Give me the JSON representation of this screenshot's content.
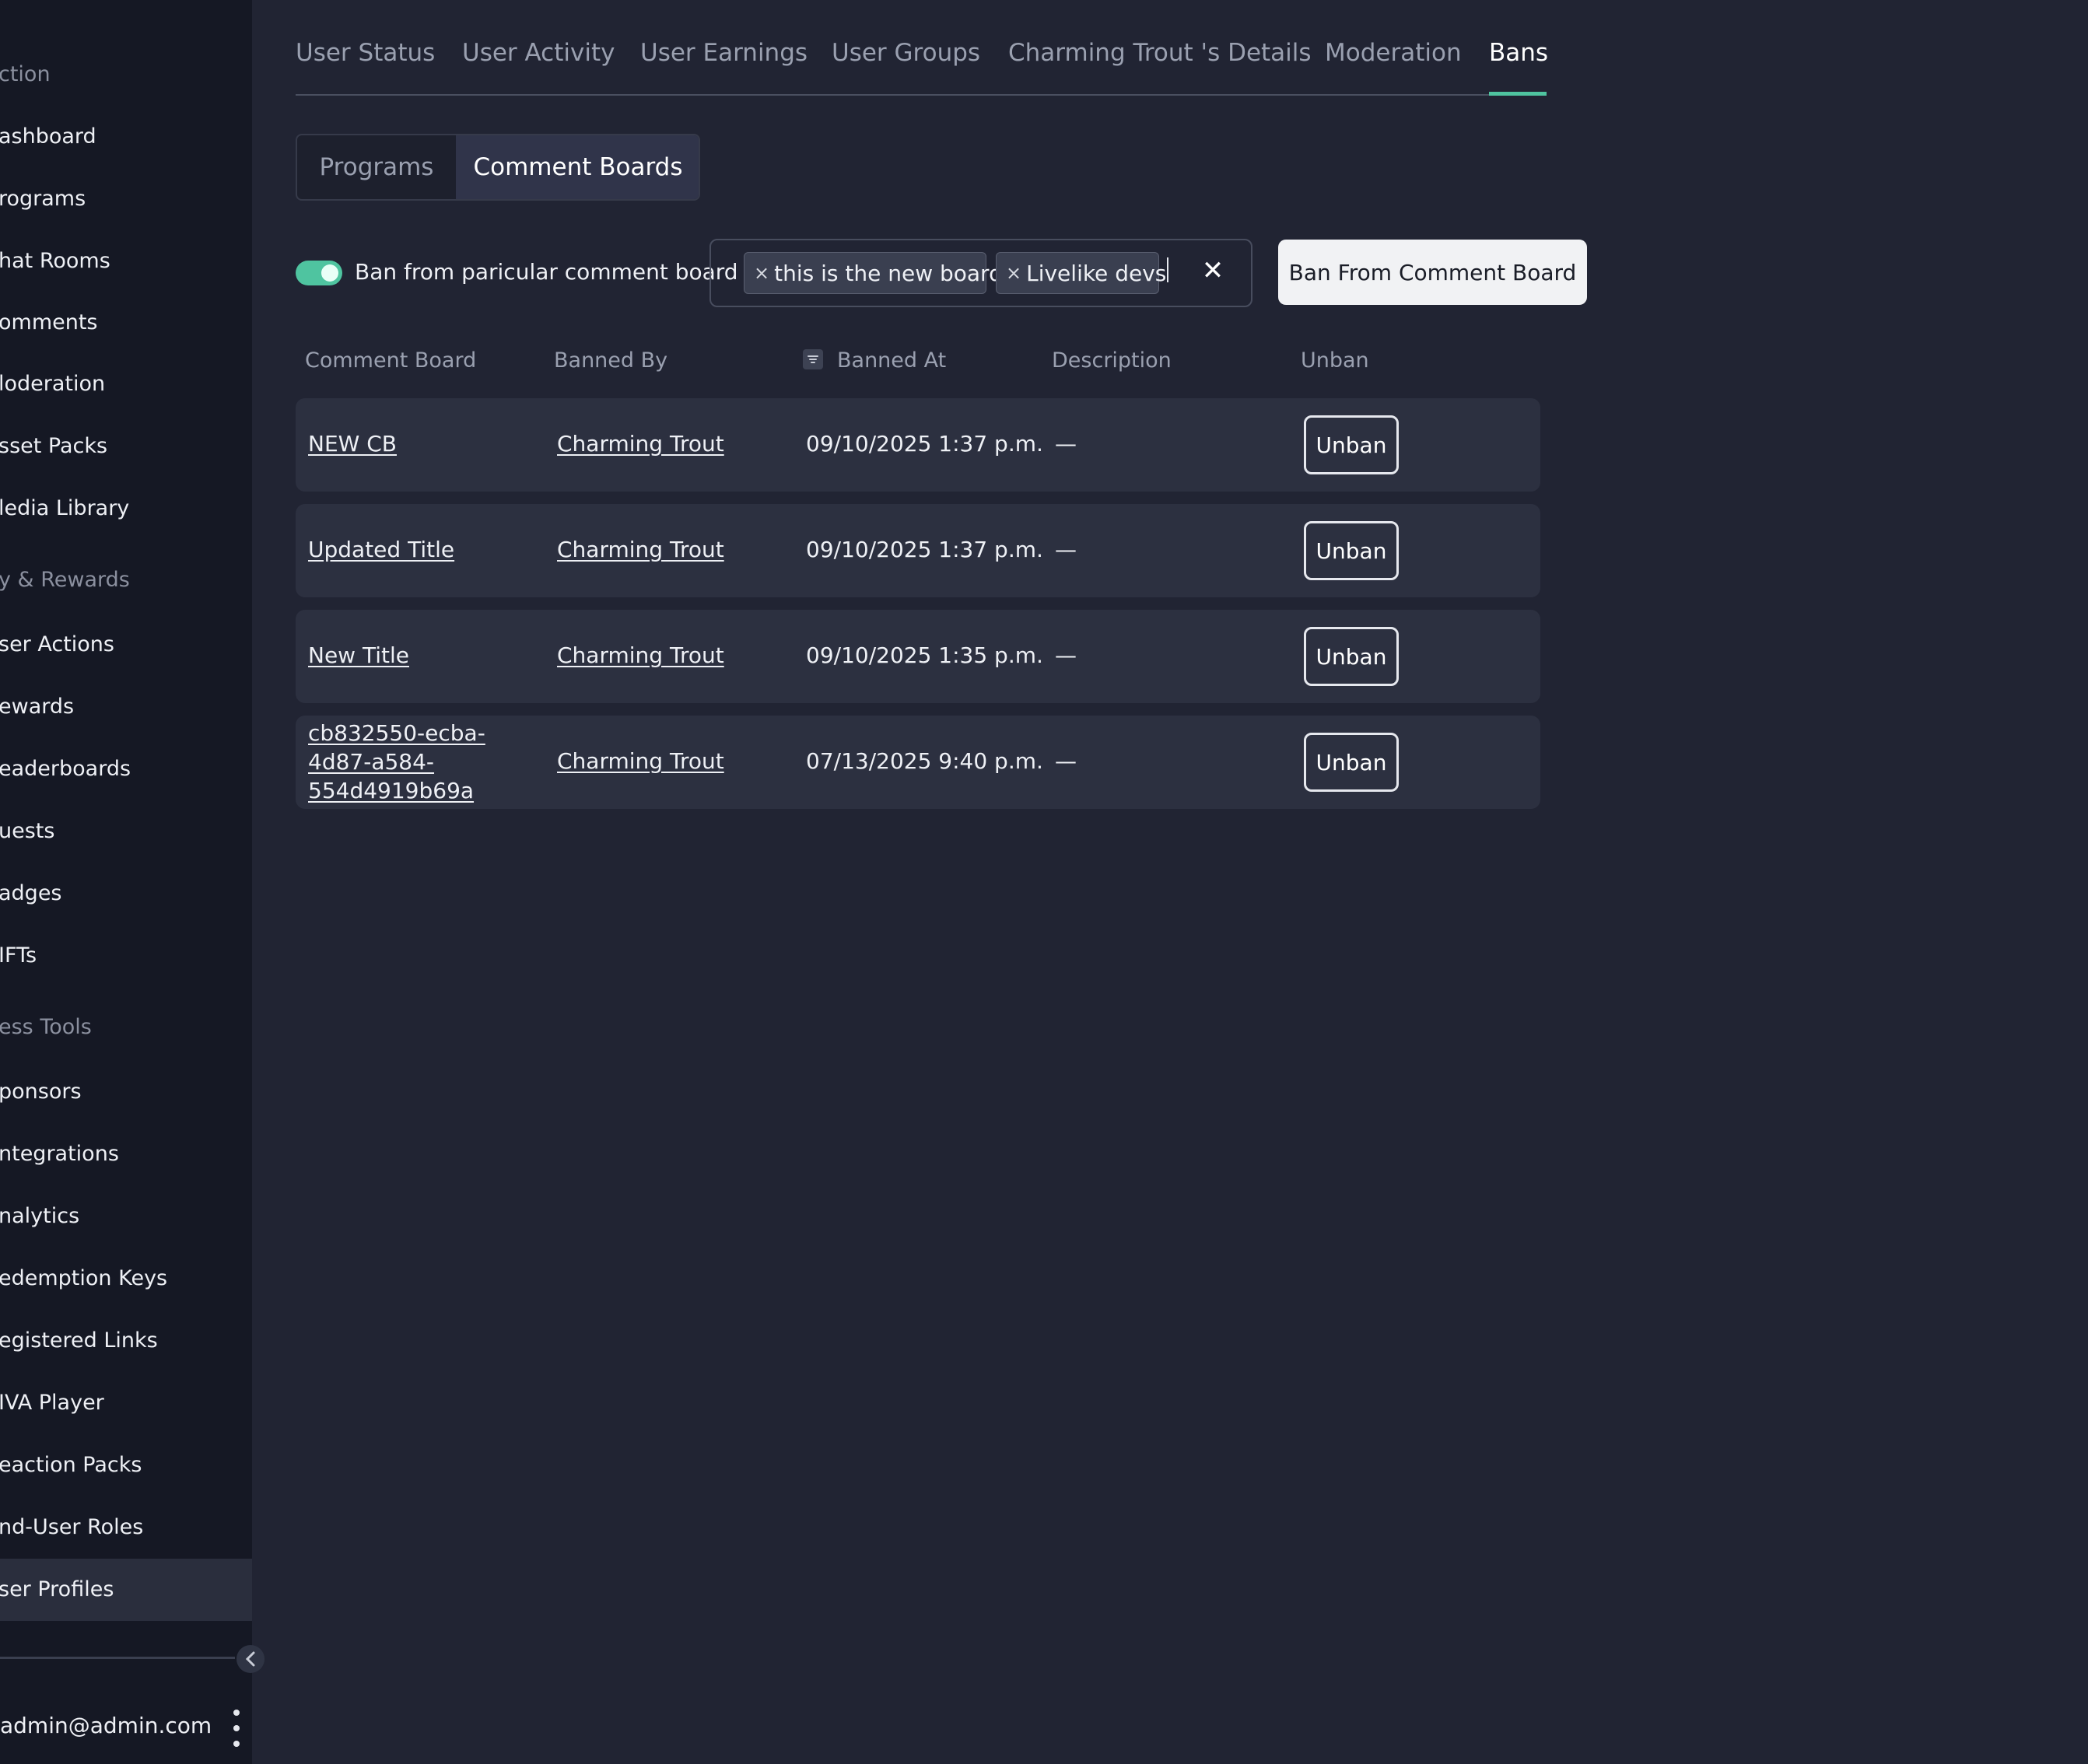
{
  "sidebar": {
    "sections": [
      "ction",
      "y & Rewards",
      "ess Tools"
    ],
    "items": [
      "ashboard",
      "rograms",
      "hat Rooms",
      "omments",
      "loderation",
      "sset Packs",
      "ledia Library",
      "ser Actions",
      "ewards",
      "eaderboards",
      "uests",
      "adges",
      "IFTs",
      "ponsors",
      "ntegrations",
      "nalytics",
      "edemption Keys",
      "egistered Links",
      "IVA Player",
      "eaction Packs",
      "nd-User Roles",
      "ser Profiles"
    ],
    "active_item": "ser Profiles",
    "user_email": "admin@admin.com"
  },
  "tabs": [
    "User Status",
    "User Activity",
    "User Earnings",
    "User Groups",
    "Charming Trout 's Details",
    "Moderation",
    "Bans"
  ],
  "active_tab": "Bans",
  "segment": {
    "options": [
      "Programs",
      "Comment Boards"
    ],
    "selected": "Comment Boards"
  },
  "ban_toggle": {
    "label": "Ban from paricular comment board",
    "on": true
  },
  "selected_boards": [
    "this is the new board",
    "Livelike devs"
  ],
  "ban_button_label": "Ban From Comment Board",
  "table": {
    "headers": [
      "Comment Board",
      "Banned By",
      "Banned At",
      "Description",
      "Unban"
    ],
    "rows": [
      {
        "board": "NEW CB",
        "banned_by": "Charming Trout",
        "banned_at": "09/10/2025 1:37 p.m.",
        "description": "—",
        "action": "Unban"
      },
      {
        "board": "Updated Title",
        "banned_by": "Charming Trout",
        "banned_at": "09/10/2025 1:37 p.m.",
        "description": "—",
        "action": "Unban"
      },
      {
        "board": "New Title",
        "banned_by": "Charming Trout",
        "banned_at": "09/10/2025 1:35 p.m.",
        "description": "—",
        "action": "Unban"
      },
      {
        "board": "cb832550-ecba-4d87-a584-554d4919b69a",
        "banned_by": "Charming Trout",
        "banned_at": "07/13/2025 9:40 p.m.",
        "description": "—",
        "action": "Unban"
      }
    ]
  },
  "colors": {
    "accent": "#4fc4a0",
    "background": "#212433",
    "sidebar": "#151824"
  }
}
